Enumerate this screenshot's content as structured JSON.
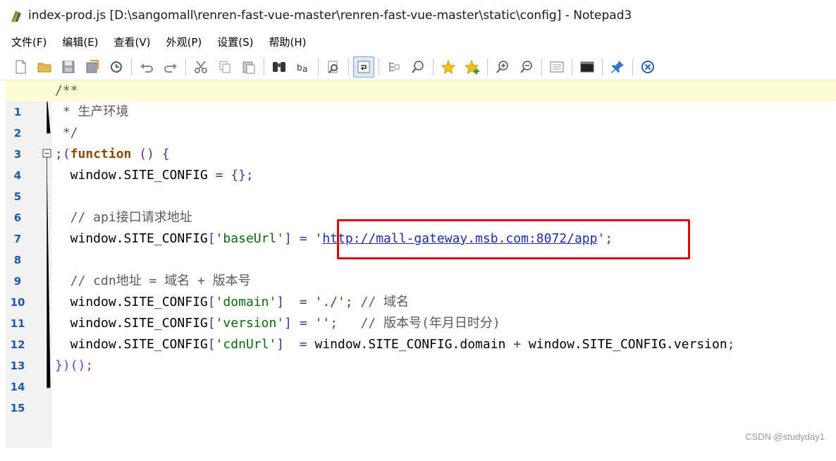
{
  "window": {
    "title": "index-prod.js [D:\\sangomall\\renren-fast-vue-master\\renren-fast-vue-master\\static\\config] - Notepad3"
  },
  "menu": [
    "文件(F)",
    "编辑(E)",
    "查看(V)",
    "外观(P)",
    "设置(S)",
    "帮助(H)"
  ],
  "toolbar": {
    "icons": [
      "new-file-icon",
      "open-folder-icon",
      "save-icon",
      "save-as-icon",
      "reload-icon",
      "undo-icon",
      "redo-icon",
      "cut-icon",
      "copy-icon",
      "paste-icon",
      "find-icon",
      "replace-icon",
      "find-in-files-icon",
      "word-wrap-icon",
      "view-whitespace-icon",
      "zoom-find-icon",
      "favorite-star-icon",
      "add-favorite-icon",
      "zoom-in-icon",
      "zoom-out-icon",
      "page-setup-icon",
      "console-icon",
      "pin-icon",
      "close-icon"
    ],
    "active": "word-wrap-icon"
  },
  "editor": {
    "current_line": 1,
    "lines": [
      {
        "num": "1",
        "text": "/**"
      },
      {
        "num": "2",
        "text": " * 生产环境"
      },
      {
        "num": "3",
        "text": " */"
      },
      {
        "num": "4",
        "text": ";(function () {"
      },
      {
        "num": "5",
        "text": "  window.SITE_CONFIG = {};"
      },
      {
        "num": "6",
        "text": ""
      },
      {
        "num": "7",
        "text": "  // api接口请求地址"
      },
      {
        "num": "8",
        "text": "  window.SITE_CONFIG['baseUrl'] = 'http://mall-gateway.msb.com:8072/app';"
      },
      {
        "num": "9",
        "text": ""
      },
      {
        "num": "10",
        "text": "  // cdn地址 = 域名 + 版本号"
      },
      {
        "num": "11",
        "text": "  window.SITE_CONFIG['domain']  = './'; // 域名"
      },
      {
        "num": "12",
        "text": "  window.SITE_CONFIG['version'] = '';   // 版本号(年月日时分)"
      },
      {
        "num": "13",
        "text": "  window.SITE_CONFIG['cdnUrl']  = window.SITE_CONFIG.domain + window.SITE_CONFIG.version;"
      },
      {
        "num": "14",
        "text": "})();"
      },
      {
        "num": "15",
        "text": ""
      }
    ],
    "base_url": "http://mall-gateway.msb.com:8072/app"
  },
  "watermark": "CSDN @studyday1",
  "colors": {
    "highlight_box": "#e00000",
    "current_line": "#fffbd1",
    "line_number": "#1c5aa6",
    "url": "#1c2ba8"
  }
}
